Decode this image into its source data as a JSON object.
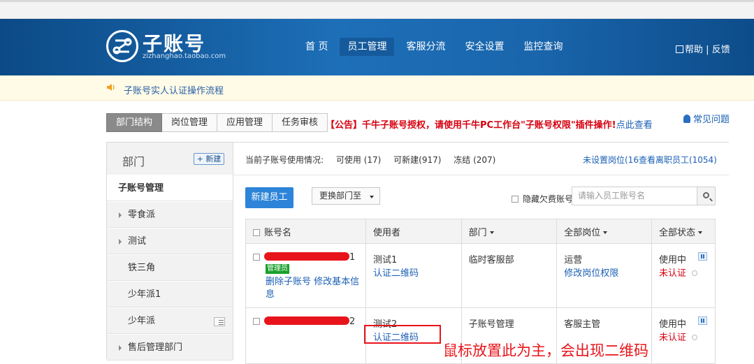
{
  "header": {
    "logo_title": "子账号",
    "logo_sub": "zizhanghao.taobao.com",
    "nav": [
      "首 页",
      "员工管理",
      "客服分流",
      "安全设置",
      "监控查询"
    ],
    "help_label": "帮助",
    "separator": "|",
    "feedback_label": "反馈"
  },
  "notice": {
    "text": "子账号实人认证操作流程"
  },
  "tabs": [
    "部门结构",
    "岗位管理",
    "应用管理",
    "任务审核"
  ],
  "announcement": {
    "prefix": "【公告】",
    "text": "千牛子账号授权，请使用千牛PC工作台\"子账号权限\"插件操作!",
    "link": "点此查看"
  },
  "faq_label": "常见问题",
  "sidebar": {
    "title": "部门",
    "new_button": "+ 新建",
    "items": [
      {
        "label": "子账号管理",
        "current": true
      },
      {
        "label": "零食派",
        "arrow": true
      },
      {
        "label": "测试",
        "arrow": true
      },
      {
        "label": "铁三角"
      },
      {
        "label": "少年派1"
      },
      {
        "label": "少年派",
        "menu": true
      },
      {
        "label": "售后管理部门",
        "arrow": true
      }
    ]
  },
  "usage": {
    "label": "当前子账号使用情况:",
    "available": "可使用 (17)",
    "creatable": "可新建(917)",
    "frozen": "冻结 (207)",
    "unset_link": "未设置岗位(16查看离职员工(1054)"
  },
  "toolbar": {
    "new_employee": "新建员工",
    "move_dept": "更换部门至",
    "hide_label": "隐藏欠费账号",
    "search_placeholder": "请输入员工账号名"
  },
  "table": {
    "headers": [
      "账号名",
      "使用者",
      "部门",
      "全部岗位",
      "全部状态"
    ],
    "rows": [
      {
        "account_suffix": "1",
        "badge": "管理员",
        "actions": "删除子账号  修改基本信息",
        "user": "测试1",
        "qr": "认证二维码",
        "dept": "临时客服部",
        "role": "运营",
        "role_action": "修改岗位权限",
        "status": "使用中",
        "auth": "未认证"
      },
      {
        "account_suffix": "2",
        "user": "测试2",
        "qr": "认证二维码",
        "dept": "子账号管理",
        "role": "客服主管",
        "status": "使用中",
        "auth": "未认证"
      }
    ]
  },
  "callout": "鼠标放置此为主，会出现二维码",
  "colors": {
    "header": "#1a66ad",
    "accent": "#2d84d8",
    "red": "#e8141b"
  }
}
